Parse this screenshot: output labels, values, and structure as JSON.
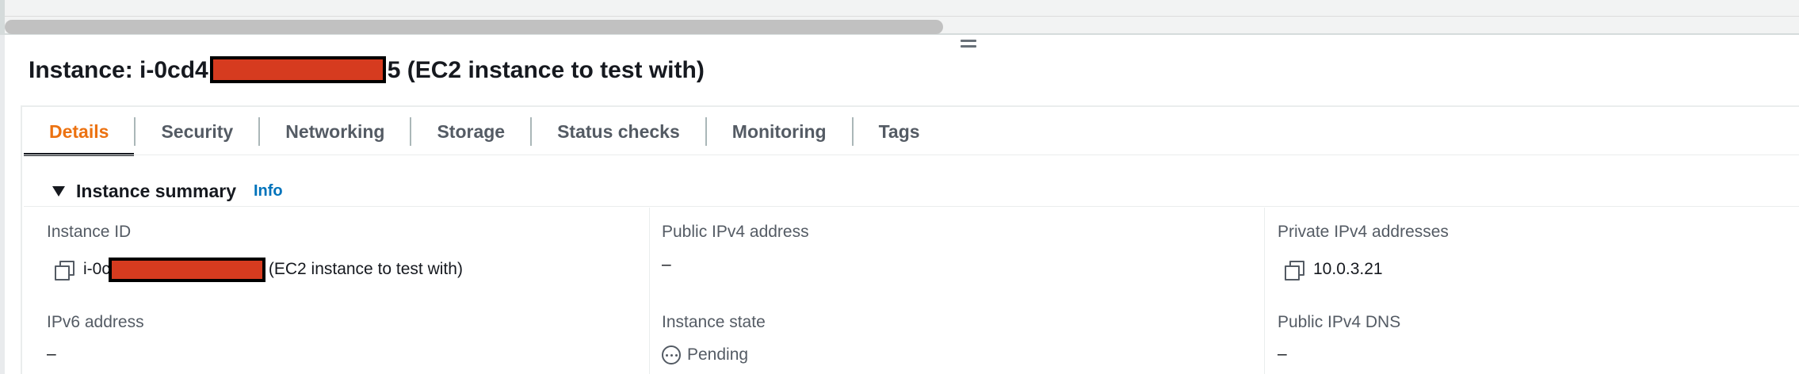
{
  "instance": {
    "title_prefix": "Instance: i-0cd4",
    "title_suffix": "5 (EC2 instance to test with)"
  },
  "tabs": [
    {
      "label": "Details",
      "active": true
    },
    {
      "label": "Security"
    },
    {
      "label": "Networking"
    },
    {
      "label": "Storage"
    },
    {
      "label": "Status checks"
    },
    {
      "label": "Monitoring"
    },
    {
      "label": "Tags"
    }
  ],
  "summary": {
    "title": "Instance summary",
    "info_link": "Info"
  },
  "fields": {
    "instance_id": {
      "label": "Instance ID",
      "value_prefix": "i-0c",
      "value_suffix": "(EC2 instance to test with)"
    },
    "public_ipv4": {
      "label": "Public IPv4 address",
      "value": "–"
    },
    "private_ipv4": {
      "label": "Private IPv4 addresses",
      "value": "10.0.3.21"
    },
    "ipv6": {
      "label": "IPv6 address",
      "value": "–"
    },
    "instance_state": {
      "label": "Instance state",
      "value": "Pending"
    },
    "public_dns": {
      "label": "Public IPv4 DNS",
      "value": "–"
    }
  },
  "colors": {
    "active_tab": "#ec7211",
    "link": "#0073bb",
    "redaction": "#d63b1f"
  },
  "icons": [
    "copy-icon",
    "pending-icon",
    "caret-down-icon",
    "drag-handle-icon"
  ]
}
